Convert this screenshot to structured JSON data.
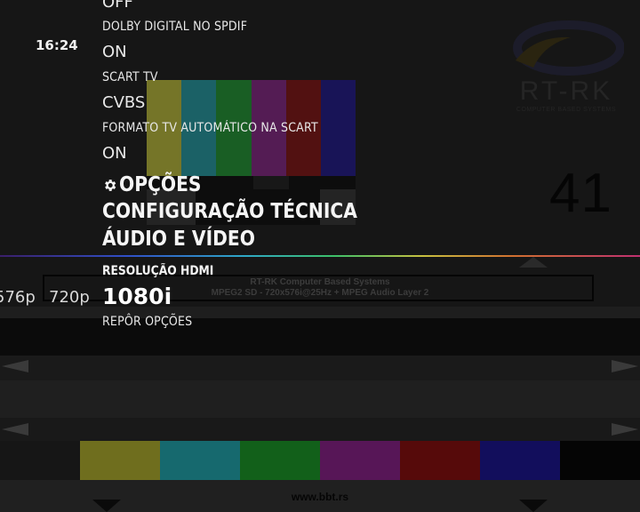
{
  "clock": "16:24",
  "channel": {
    "number": "41",
    "info_line1": "RT-RK Computer Based Systems",
    "info_line2": "MPEG2 SD - 720x576i@25Hz + MPEG Audio Layer 2",
    "website": "www.bbt.rs"
  },
  "logo": {
    "name": "RT-RK",
    "tagline": "COMPUTER BASED SYSTEMS"
  },
  "pattern_colors": {
    "top": [
      "#9a9a30",
      "#1d7f86",
      "#1b7b2a",
      "#6d1f6d",
      "#6a1010",
      "#1a1470"
    ],
    "bottom": [
      "#6f6e1e",
      "#16696e",
      "#12601a",
      "#571657",
      "#560a0a",
      "#120e5c",
      "#050505"
    ]
  },
  "menu": {
    "items": [
      {
        "label": "",
        "value": "OFF"
      },
      {
        "label": "DOLBY DIGITAL NO SPDIF",
        "value": "ON"
      },
      {
        "label": "SCART TV",
        "value": "CVBS"
      },
      {
        "label": "FORMATO TV AUTOMÁTICO NA SCART",
        "value": "ON"
      }
    ],
    "breadcrumb": {
      "icon": "gear-icon",
      "level1": "OPÇÕES",
      "level2": "CONFIGURAÇÃO TÉCNICA",
      "level3": "ÁUDIO E VÍDEO"
    },
    "selected": {
      "label": "RESOLUÇÃO HDMI",
      "value": "1080i",
      "options_before": [
        "576p",
        "720p"
      ]
    },
    "next_item": {
      "label": "REPÔR OPÇÕES"
    }
  }
}
